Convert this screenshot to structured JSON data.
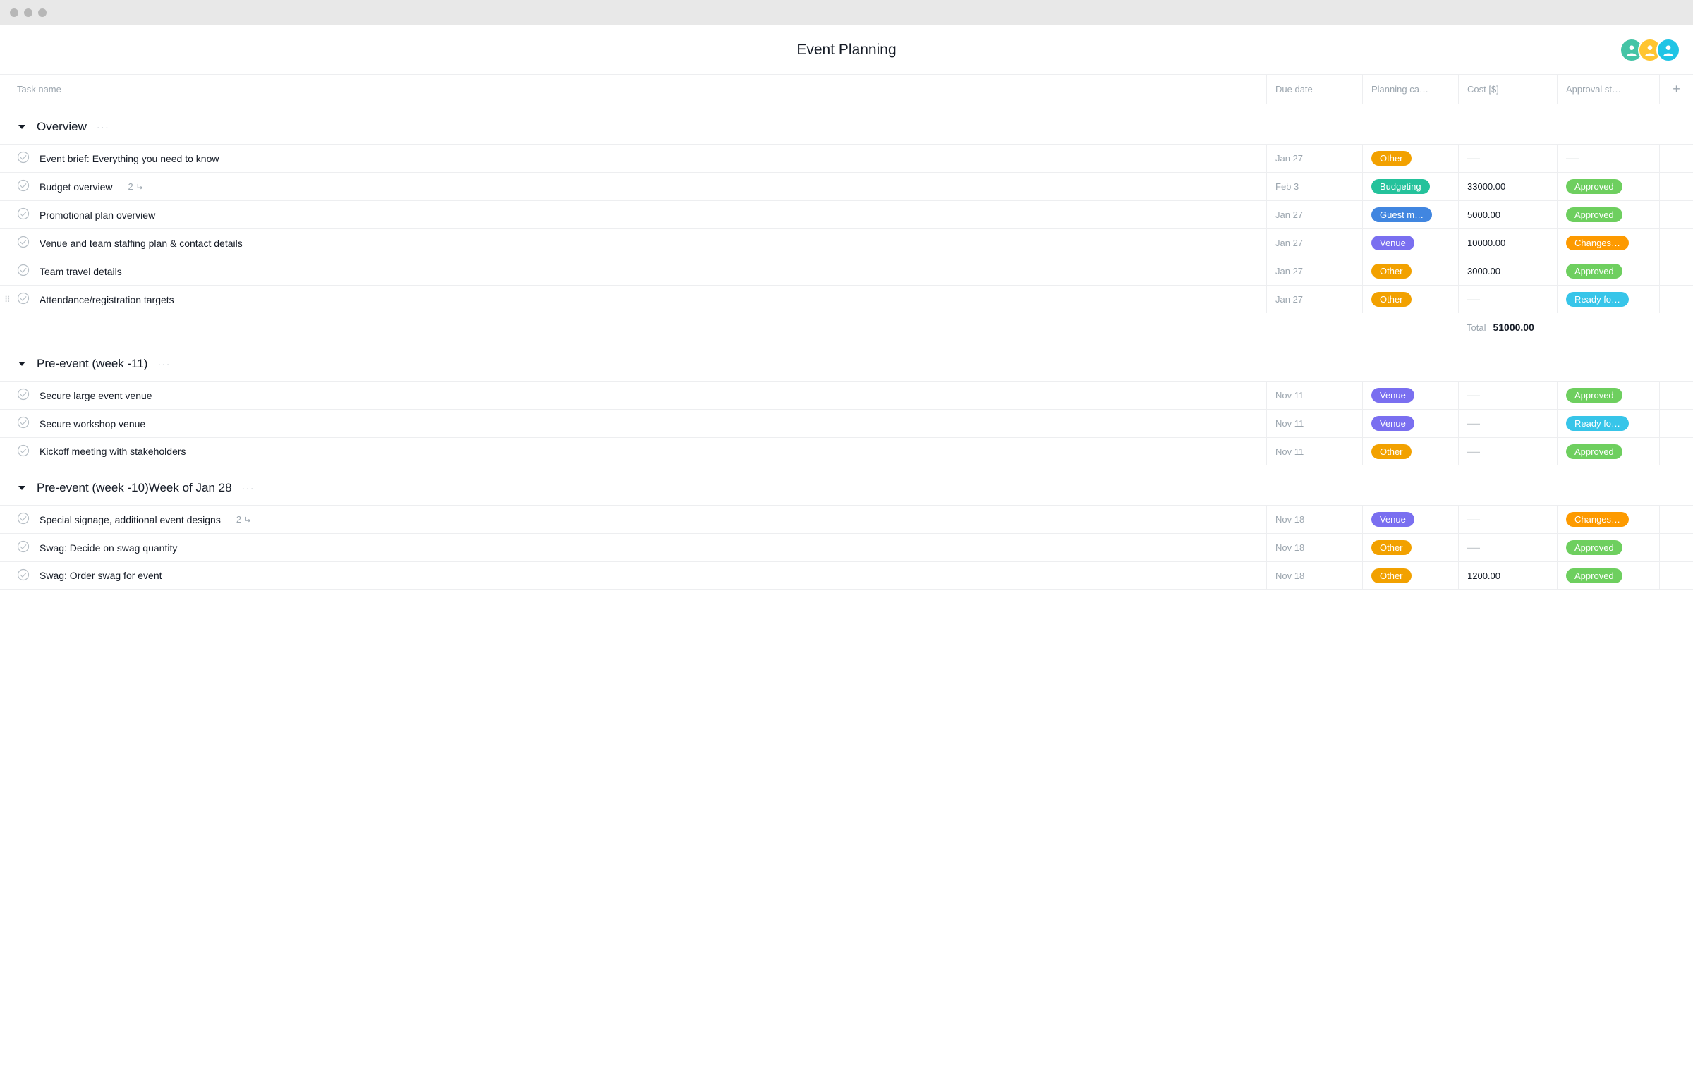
{
  "page_title": "Event Planning",
  "avatars": [
    {
      "bg": "#44c4a5"
    },
    {
      "bg": "#ffc531"
    },
    {
      "bg": "#1fc4e5"
    }
  ],
  "columns": {
    "task": "Task name",
    "due": "Due date",
    "planning": "Planning ca…",
    "cost": "Cost [$]",
    "approval": "Approval st…"
  },
  "pill_colors": {
    "Other": "#f2a100",
    "Budgeting": "#24c29b",
    "Guest m…": "#4186e0",
    "Venue": "#7a6ff0",
    "Approved": "#6ecf5f",
    "Changes…": "#fd9a00",
    "Ready fo…": "#37c5e9"
  },
  "sections": [
    {
      "title": "Overview",
      "tasks": [
        {
          "name": "Event brief: Everything you need to know",
          "due": "Jan 27",
          "planning": "Other",
          "cost": "",
          "approval": ""
        },
        {
          "name": "Budget overview",
          "due": "Feb 3",
          "planning": "Budgeting",
          "cost": "33000.00",
          "approval": "Approved",
          "subtasks": "2"
        },
        {
          "name": "Promotional plan overview",
          "due": "Jan 27",
          "planning": "Guest m…",
          "cost": "5000.00",
          "approval": "Approved"
        },
        {
          "name": "Venue and team staffing plan & contact details",
          "due": "Jan 27",
          "planning": "Venue",
          "cost": "10000.00",
          "approval": "Changes…"
        },
        {
          "name": "Team travel details",
          "due": "Jan 27",
          "planning": "Other",
          "cost": "3000.00",
          "approval": "Approved"
        },
        {
          "name": "Attendance/registration targets",
          "due": "Jan 27",
          "planning": "Other",
          "cost": "",
          "approval": "Ready fo…",
          "drag_visible": true
        }
      ],
      "total_label": "Total",
      "total_value": "51000.00"
    },
    {
      "title": "Pre-event (week -11)",
      "tasks": [
        {
          "name": "Secure large event venue",
          "due": "Nov 11",
          "planning": "Venue",
          "cost": "",
          "approval": "Approved"
        },
        {
          "name": "Secure workshop venue",
          "due": "Nov 11",
          "planning": "Venue",
          "cost": "",
          "approval": "Ready fo…"
        },
        {
          "name": "Kickoff meeting with stakeholders",
          "due": "Nov 11",
          "planning": "Other",
          "cost": "",
          "approval": "Approved"
        }
      ]
    },
    {
      "title": "Pre-event (week -10)Week of Jan 28",
      "tasks": [
        {
          "name": "Special signage, additional event designs",
          "due": "Nov 18",
          "planning": "Venue",
          "cost": "",
          "approval": "Changes…",
          "subtasks": "2"
        },
        {
          "name": "Swag: Decide on swag quantity",
          "due": "Nov 18",
          "planning": "Other",
          "cost": "",
          "approval": "Approved"
        },
        {
          "name": "Swag: Order swag for event",
          "due": "Nov 18",
          "planning": "Other",
          "cost": "1200.00",
          "approval": "Approved"
        }
      ]
    }
  ]
}
